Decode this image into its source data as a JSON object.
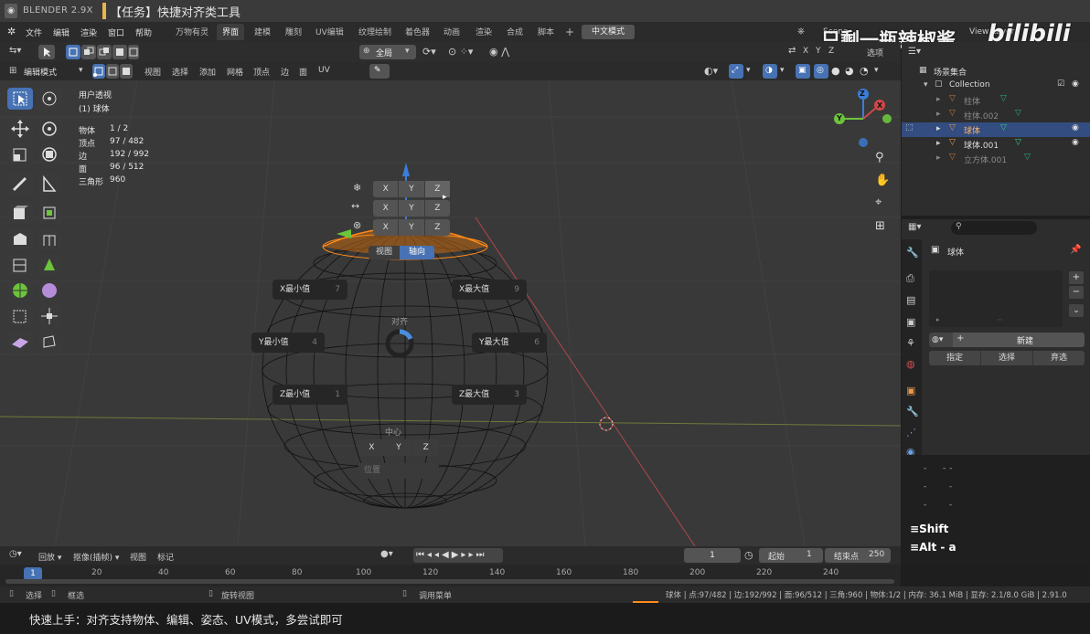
{
  "title_bar": {
    "app_name": "BLENDER 2.9X",
    "task_title": "【任务】快捷对齐类工具"
  },
  "menu": {
    "items": [
      "文件",
      "编辑",
      "渲染",
      "窗口",
      "帮助"
    ]
  },
  "workspace_tabs": [
    "万物有灵",
    "界面",
    "建模",
    "雕刻",
    "UV编辑",
    "纹理绘制",
    "着色器",
    "动画",
    "渲染",
    "合成",
    "脚本"
  ],
  "language_button": "中文模式",
  "scene": {
    "scene_label": "Scene",
    "view_layer_label": "View Layer"
  },
  "watermark": {
    "text": "只剩一瓶辣椒酱",
    "brand": "bilibili"
  },
  "header1": {
    "orientation_label": "全局",
    "options_label": "选项",
    "axes": [
      "X",
      "Y",
      "Z"
    ]
  },
  "header2": {
    "mode_label": "编辑模式",
    "menu_items": [
      "视图",
      "选择",
      "添加",
      "网格",
      "顶点",
      "边",
      "面",
      "UV"
    ]
  },
  "overlay": {
    "view_name": "用户透视",
    "object_name": "(1) 球体",
    "stats": [
      {
        "label": "物体",
        "value": "1 / 2"
      },
      {
        "label": "顶点",
        "value": "97 / 482"
      },
      {
        "label": "边",
        "value": "192 / 992"
      },
      {
        "label": "面",
        "value": "96 / 512"
      },
      {
        "label": "三角形",
        "value": "960"
      }
    ]
  },
  "align_pie": {
    "axis_rows": [
      [
        "X",
        "Y",
        "Z"
      ],
      [
        "X",
        "Y",
        "Z"
      ],
      [
        "X",
        "Y",
        "Z"
      ]
    ],
    "mode_tabs": [
      "视图",
      "轴向"
    ],
    "active_tab": "轴向",
    "center_label": "对齐",
    "items": [
      {
        "label": "X最小值",
        "key": "7"
      },
      {
        "label": "X最大值",
        "key": "9"
      },
      {
        "label": "Y最小值",
        "key": "4"
      },
      {
        "label": "Y最大值",
        "key": "6"
      },
      {
        "label": "Z最小值",
        "key": "1"
      },
      {
        "label": "Z最大值",
        "key": "3"
      }
    ],
    "center_group_label": "中心",
    "center_axes": [
      "X",
      "Y",
      "Z"
    ],
    "position_label": "位置"
  },
  "gizmo": {
    "x": "X",
    "y": "Y",
    "z": "Z"
  },
  "outliner": {
    "root": "场景集合",
    "collection": "Collection",
    "items": [
      {
        "name": "柱体",
        "selected": false,
        "visible": false
      },
      {
        "name": "柱体.002",
        "selected": false,
        "visible": false
      },
      {
        "name": "球体",
        "selected": true,
        "visible": true
      },
      {
        "name": "球体.001",
        "selected": false,
        "visible": true
      },
      {
        "name": "立方体.001",
        "selected": false,
        "visible": false
      }
    ]
  },
  "properties": {
    "object_name": "球体",
    "new_button": "新建",
    "assign_button": "指定",
    "select_button": "选择",
    "deselect_button": "弃选"
  },
  "key_display": {
    "lines": [
      "Shift",
      "Alt - a"
    ]
  },
  "timeline": {
    "menu_items": [
      "回放",
      "抠像(插帧)",
      "视图",
      "标记"
    ],
    "current_frame": "1",
    "start_label": "起始",
    "start_value": "1",
    "end_label": "结束点",
    "end_value": "250",
    "ticks": [
      "1",
      "20",
      "40",
      "60",
      "80",
      "100",
      "120",
      "140",
      "160",
      "180",
      "200",
      "220",
      "240"
    ]
  },
  "status_bar": {
    "select": "选择",
    "box_select": "框选",
    "rotate_view": "旋转视图",
    "call_menu": "调用菜单",
    "stats": "球体 | 点:97/482 | 边:192/992 | 面:96/512 | 三角:960 | 物体:1/2 | 内存: 36.1 MiB | 显存: 2.1/8.0 GiB | 2.91.0"
  },
  "subtitle": "快速上手：对齐支持物体、编辑、姿态、UV模式，多尝试即可",
  "colors": {
    "accent": "#4772b3",
    "title_accent": "#e8b64a",
    "select_orange": "#ff8a1a"
  }
}
